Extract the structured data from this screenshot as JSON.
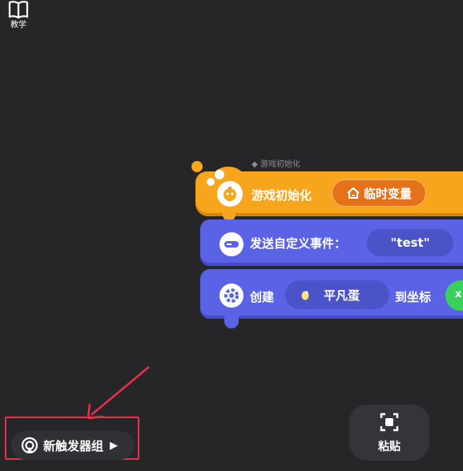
{
  "toolbar": {
    "tutorial_label": "教学"
  },
  "script": {
    "group_caption": "◆ 游戏初始化",
    "event_block": {
      "label": "游戏初始化",
      "temp_var_button": "临时变量"
    },
    "send_block": {
      "label": "发送自定义事件：",
      "event_name": "\"test\""
    },
    "create_block": {
      "label": "创建",
      "object": "平凡蛋",
      "to_label": "到坐标",
      "coord_partial": "x"
    }
  },
  "bottom_bar": {
    "new_trigger_group": "新触发器组",
    "paste": "粘贴"
  },
  "colors": {
    "event": "#f7a51c",
    "action": "#5a63e6",
    "highlight": "#e8324b",
    "coord": "#3ad05a",
    "background": "#262629"
  },
  "icons": [
    "book-icon",
    "temp-var-icon",
    "event-icon",
    "message-icon",
    "create-gear-icon",
    "egg-icon",
    "trigger-group-icon",
    "chevron-right-icon",
    "paste-icon",
    "red-arrow"
  ]
}
